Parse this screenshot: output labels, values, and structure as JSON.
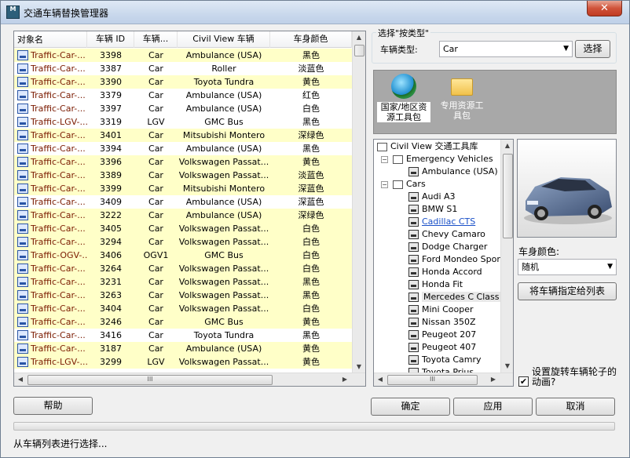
{
  "window": {
    "title": "交通车辆替换管理器",
    "icon_text": "M",
    "close_glyph": "✕"
  },
  "list": {
    "columns": [
      "对象名",
      "车辆 ID",
      "车辆...",
      "Civil View 车辆",
      "车身颜色"
    ],
    "rows": [
      [
        "Traffic-Car-...",
        "3398",
        "Car",
        "Ambulance (USA)",
        "黑色"
      ],
      [
        "Traffic-Car-...",
        "3387",
        "Car",
        "Roller",
        "淡蓝色"
      ],
      [
        "Traffic-Car-...",
        "3390",
        "Car",
        "Toyota Tundra",
        "黄色"
      ],
      [
        "Traffic-Car-...",
        "3379",
        "Car",
        "Ambulance (USA)",
        "红色"
      ],
      [
        "Traffic-Car-...",
        "3397",
        "Car",
        "Ambulance (USA)",
        "白色"
      ],
      [
        "Traffic-LGV-...",
        "3319",
        "LGV",
        "GMC Bus",
        "黑色"
      ],
      [
        "Traffic-Car-...",
        "3401",
        "Car",
        "Mitsubishi Montero",
        "深绿色"
      ],
      [
        "Traffic-Car-...",
        "3394",
        "Car",
        "Ambulance (USA)",
        "黑色"
      ],
      [
        "Traffic-Car-...",
        "3396",
        "Car",
        "Volkswagen Passat...",
        "黄色"
      ],
      [
        "Traffic-Car-...",
        "3389",
        "Car",
        "Volkswagen Passat...",
        "淡蓝色"
      ],
      [
        "Traffic-Car-...",
        "3399",
        "Car",
        "Mitsubishi Montero",
        "深蓝色"
      ],
      [
        "Traffic-Car-...",
        "3409",
        "Car",
        "Ambulance (USA)",
        "深蓝色"
      ],
      [
        "Traffic-Car-...",
        "3222",
        "Car",
        "Ambulance (USA)",
        "深绿色"
      ],
      [
        "Traffic-Car-...",
        "3405",
        "Car",
        "Volkswagen Passat...",
        "白色"
      ],
      [
        "Traffic-Car-...",
        "3294",
        "Car",
        "Volkswagen Passat...",
        "白色"
      ],
      [
        "Traffic-OGV-...",
        "3406",
        "OGV1",
        "GMC Bus",
        "白色"
      ],
      [
        "Traffic-Car-...",
        "3264",
        "Car",
        "Volkswagen Passat...",
        "白色"
      ],
      [
        "Traffic-Car-...",
        "3231",
        "Car",
        "Volkswagen Passat...",
        "黑色"
      ],
      [
        "Traffic-Car-...",
        "3263",
        "Car",
        "Volkswagen Passat...",
        "黑色"
      ],
      [
        "Traffic-Car-...",
        "3404",
        "Car",
        "Volkswagen Passat...",
        "白色"
      ],
      [
        "Traffic-Car-...",
        "3246",
        "Car",
        "GMC Bus",
        "黄色"
      ],
      [
        "Traffic-Car-...",
        "3416",
        "Car",
        "Toyota Tundra",
        "黑色"
      ],
      [
        "Traffic-Car-...",
        "3187",
        "Car",
        "Ambulance (USA)",
        "黄色"
      ],
      [
        "Traffic-LGV-...",
        "3299",
        "LGV",
        "Volkswagen Passat...",
        "黄色"
      ]
    ],
    "row_shading": [
      "y",
      "w",
      "y",
      "w",
      "w",
      "w",
      "y",
      "w",
      "y",
      "y",
      "y",
      "w",
      "y",
      "y",
      "y",
      "y",
      "y",
      "y",
      "y",
      "y",
      "y",
      "w",
      "y",
      "y"
    ],
    "hscroll_grip": "III"
  },
  "select_by_type": {
    "group_title": "选择\"按类型\"",
    "type_label": "车辆类型:",
    "type_value": "Car",
    "select_button": "选择"
  },
  "toolbox": {
    "items": [
      {
        "label_line1": "国家/地区资",
        "label_line2": "源工具包",
        "icon": "globe-icon"
      },
      {
        "label_line1": "专用资源工",
        "label_line2": "具包",
        "icon": "folder-icon"
      }
    ]
  },
  "tree": {
    "root": "Civil View 交通工具库",
    "nodes": [
      {
        "label": "Emergency Vehicles",
        "kind": "folder"
      },
      {
        "label": "Ambulance (USA)",
        "kind": "vehicle"
      },
      {
        "label": "Cars",
        "kind": "folder"
      },
      {
        "label": "Audi A3",
        "kind": "vehicle"
      },
      {
        "label": "BMW S1",
        "kind": "vehicle"
      },
      {
        "label": "Cadillac CTS",
        "kind": "vehicle",
        "style": "link"
      },
      {
        "label": "Chevy Camaro",
        "kind": "vehicle"
      },
      {
        "label": "Dodge Charger",
        "kind": "vehicle"
      },
      {
        "label": "Ford Mondeo Sportb",
        "kind": "vehicle"
      },
      {
        "label": "Honda Accord",
        "kind": "vehicle"
      },
      {
        "label": "Honda Fit",
        "kind": "vehicle"
      },
      {
        "label": "Mercedes C Class",
        "kind": "vehicle",
        "style": "selected"
      },
      {
        "label": "Mini Cooper",
        "kind": "vehicle"
      },
      {
        "label": "Nissan 350Z",
        "kind": "vehicle"
      },
      {
        "label": "Peugeot 207",
        "kind": "vehicle"
      },
      {
        "label": "Peugeot 407",
        "kind": "vehicle"
      },
      {
        "label": "Toyota Camry",
        "kind": "vehicle"
      },
      {
        "label": "Toyota Prius",
        "kind": "vehicle"
      }
    ],
    "hscroll_grip": "III"
  },
  "color": {
    "label": "车身颜色:",
    "value": "随机",
    "assign_button": "将车辆指定给列表"
  },
  "wheels": {
    "label_line1": "设置旋转车辆轮子的",
    "label_line2": "动画?",
    "checked": true,
    "check_glyph": "✔"
  },
  "buttons": {
    "help": "帮助",
    "ok": "确定",
    "apply": "应用",
    "cancel": "取消"
  },
  "status": "从车辆列表进行选择...",
  "scroll_glyphs": {
    "up": "▲",
    "down": "▼",
    "left": "◀",
    "right": "▶"
  }
}
